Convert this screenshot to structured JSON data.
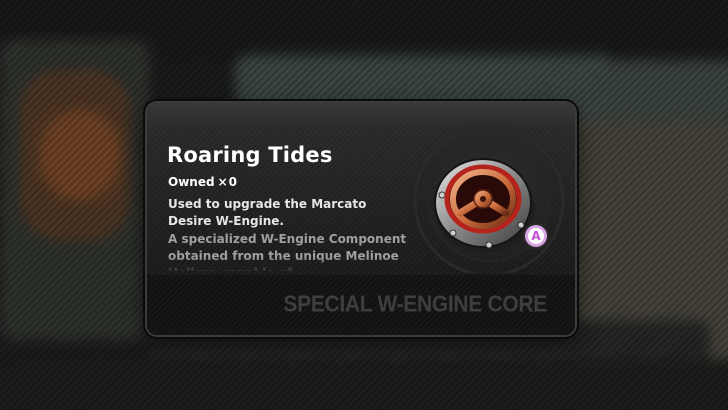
{
  "item": {
    "name": "Roaring Tides",
    "owned_label": "Owned",
    "owned_separator": "×",
    "owned_count": "0",
    "usage": "Used to upgrade the Marcato Desire W-Engine.",
    "lore": "A specialized W-Engine Component obtained from the unique Melinoe Hollow, capable of",
    "category": "SPECIAL W-ENGINE CORE",
    "rank": "A",
    "icon": "w-engine-core-icon"
  },
  "colors": {
    "rank_badge": "#d9a6e4",
    "rank_letter": "#c34fd6",
    "core_copper": "#c96a3a",
    "core_red": "#b4241c"
  }
}
